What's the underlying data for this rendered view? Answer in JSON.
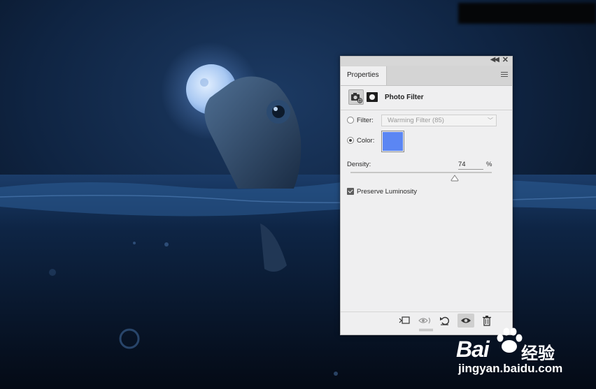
{
  "panel": {
    "tab_label": "Properties",
    "title": "Photo Filter",
    "filter_label": "Filter:",
    "filter_value": "Warming Filter (85)",
    "color_label": "Color:",
    "color_value": "#5b86f3",
    "density_label": "Density:",
    "density_value": "74",
    "density_unit": "%",
    "density_fraction": 0.74,
    "preserve_label": "Preserve Luminosity",
    "preserve_checked": true,
    "selected_mode": "color"
  },
  "icons": {
    "tab_menu": "hamburger-menu-icon",
    "header": [
      "camera-adjustment-icon",
      "layer-mask-icon"
    ],
    "footer": [
      "clip-to-layer-icon",
      "view-previous-state-icon",
      "reset-icon",
      "visibility-eye-icon",
      "trash-icon"
    ]
  },
  "watermark": {
    "brand": "Bai",
    "brand_cn": "经验",
    "url": "jingyan.baidu.com"
  },
  "colors": {
    "panel_bg": "#efeff0",
    "swatch": "#5b86f3",
    "scene_dark": "#081426",
    "moon": "#b9d4f5"
  }
}
